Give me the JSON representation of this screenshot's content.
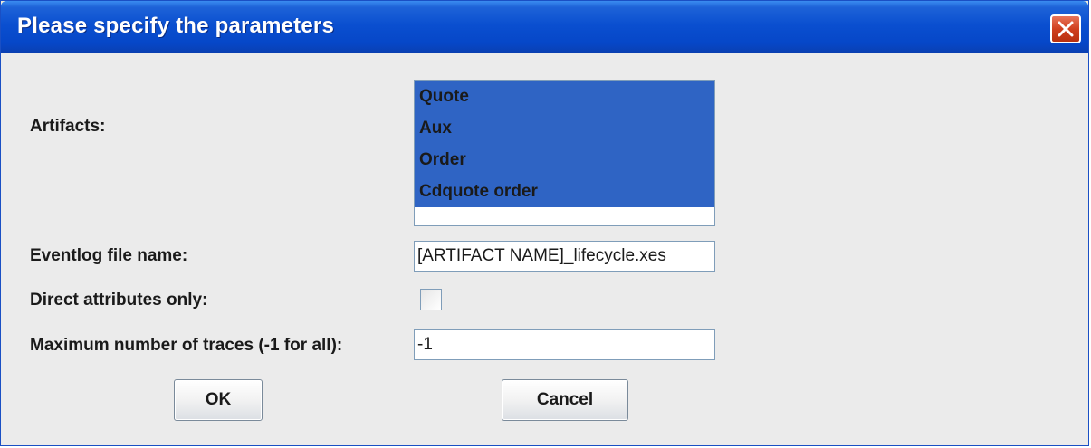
{
  "window": {
    "title": "Please specify the parameters"
  },
  "artifacts": {
    "label": "Artifacts:",
    "items": [
      "Quote",
      "Aux",
      "Order",
      "Cdquote order"
    ]
  },
  "eventlog": {
    "label": "Eventlog file name:",
    "value": "[ARTIFACT NAME]_lifecycle.xes"
  },
  "direct_attributes": {
    "label": "Direct attributes only:",
    "checked": false
  },
  "max_traces": {
    "label": "Maximum number of traces (-1 for all):",
    "value": "-1"
  },
  "buttons": {
    "ok": "OK",
    "cancel": "Cancel"
  },
  "colors": {
    "title_bar": "#0a4fd0",
    "selection": "#2f64c4",
    "close_button": "#d0401f"
  }
}
